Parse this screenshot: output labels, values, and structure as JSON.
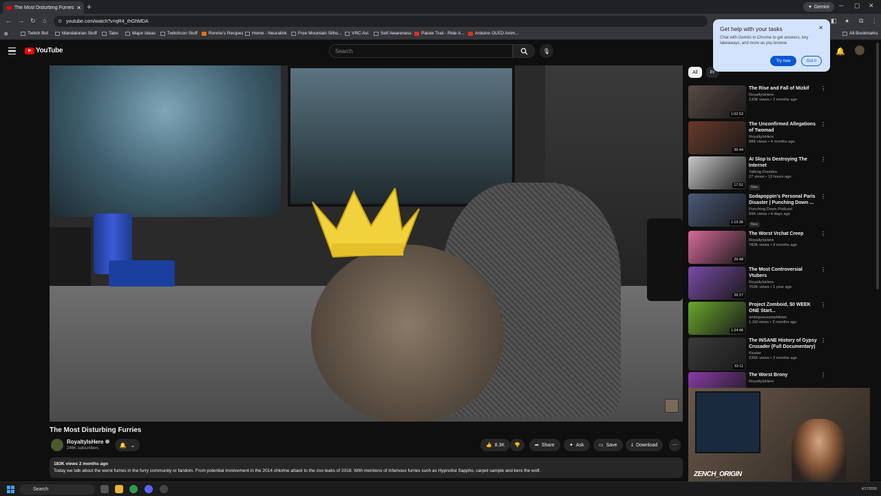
{
  "browser": {
    "tab_title": "The Most Disturbing Furries - Yo",
    "url": "youtube.com/watch?v=qR4_rhGhMDA",
    "gemini_label": "Gemini",
    "all_bookmarks": "All Bookmarks",
    "bookmarks": [
      {
        "label": "Twitch Bot",
        "icon": "folder-icon"
      },
      {
        "label": "Mandalorian Stuff",
        "icon": "folder-icon"
      },
      {
        "label": "Tabs",
        "icon": "folder-icon"
      },
      {
        "label": "Major Ideas",
        "icon": "folder-icon"
      },
      {
        "label": "Twitchcon Stuff",
        "icon": "folder-icon"
      },
      {
        "label": "Ronnie's Recipes",
        "icon": "orange-site-icon"
      },
      {
        "label": "Home - Neuralink",
        "icon": "neuralink-icon"
      },
      {
        "label": "Free Mountain Silho...",
        "icon": "site-icon"
      },
      {
        "label": "VRC Avi",
        "icon": "folder-icon"
      },
      {
        "label": "Self Awareness",
        "icon": "folder-icon"
      },
      {
        "label": "Paiute Trail - Ride A...",
        "icon": "red-site-icon"
      },
      {
        "label": "Arduino OLED Anim...",
        "icon": "youtube-icon"
      }
    ]
  },
  "youtube": {
    "logo_text": "YouTube",
    "search_placeholder": "Search",
    "video": {
      "title": "The Most Disturbing Furries",
      "channel": "RoyaltyIsHere",
      "subscribers": "246K subscribers",
      "likes": "8.3K",
      "share": "Share",
      "ask": "Ask",
      "save": "Save",
      "download": "Download",
      "views_date": "183K views  2 months ago",
      "description": "Today we talk about the worst furries in the furry community or fandom. From potential involvement in the 2014 chlorine attack to the zoo leaks of 2018. With mentions of infamous furries such as Hypnotist Sappho, carpet sample and kero the wolf."
    },
    "chips": [
      {
        "label": "All",
        "active": true
      },
      {
        "label": "Fr",
        "active": false
      }
    ],
    "recommendations": [
      {
        "title": "The Rise and Fall of Mizkif",
        "channel": "RoyaltyIsHere",
        "meta": "130K views • 2 months ago",
        "duration": "1:02:53",
        "new": "",
        "thumb_color": "#5a4a44"
      },
      {
        "title": "The Unconfirmed Allegations of Twomad",
        "channel": "RoyaltyIsHere",
        "meta": "88K views • 4 months ago",
        "duration": "36:44",
        "new": "",
        "thumb_color": "#6a3a2a"
      },
      {
        "title": "AI Slop Is Destroying The Internet",
        "channel": "Talking Doodles",
        "meta": "27 views • 13 hours ago",
        "duration": "17:51",
        "new": "New",
        "thumb_color": "#c8c8c8"
      },
      {
        "title": "Sodapoppin's Personal Paris Disaster | Punching Down ...",
        "channel": "Punching Down Podcast",
        "meta": "59K views • 4 days ago",
        "duration": "1:13:36",
        "new": "New",
        "thumb_color": "#4a5a7a"
      },
      {
        "title": "The Worst Vrchat Creep",
        "channel": "RoyaltyIsHere",
        "meta": "782K views • 9 months ago",
        "duration": "29:48",
        "new": "",
        "thumb_color": "#d86a9a"
      },
      {
        "title": "The Most Controversial Vtubers",
        "channel": "RoyaltyIsHere",
        "meta": "702K views • 1 year ago",
        "duration": "26:27",
        "new": "",
        "thumb_color": "#7a4aa8"
      },
      {
        "title": "Project Zomboid, $0 WEEK ONE Start...",
        "channel": "ambiguousamphibian",
        "meta": "1.1M views • 3 months ago",
        "duration": "1:24:46",
        "new": "",
        "thumb_color": "#6aa82a"
      },
      {
        "title": "The INSANE History of Gypsy Crusader (Full Documentary)",
        "channel": "Kiuster",
        "meta": "236K views • 3 months ago",
        "duration": "32:11",
        "new": "",
        "thumb_color": "#3a3a3a"
      },
      {
        "title": "The Worst Brony",
        "channel": "RoyaltyIsHere",
        "meta": "",
        "duration": "",
        "new": "",
        "thumb_color": "#8a3aa8"
      }
    ]
  },
  "gemini_popup": {
    "heading": "Get help with your tasks",
    "body": "Chat with Gemini in Chrome to get answers, key takeaways, and more as you browse",
    "try_now": "Try now",
    "got_it": "Got it"
  },
  "webcam": {
    "brand": "ZENCH_ORIGIN"
  },
  "taskbar": {
    "search_label": "Search",
    "date": "4/17/2026"
  }
}
